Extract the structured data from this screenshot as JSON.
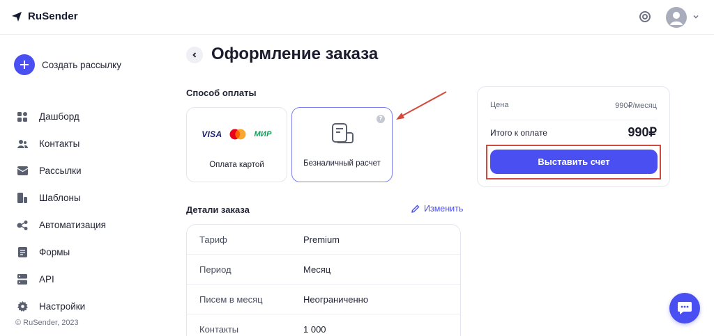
{
  "app": {
    "name": "RuSender"
  },
  "sidebar": {
    "create_label": "Создать рассылку",
    "items": [
      {
        "label": "Дашборд",
        "icon": "dashboard-icon"
      },
      {
        "label": "Контакты",
        "icon": "contacts-icon"
      },
      {
        "label": "Рассылки",
        "icon": "mail-icon"
      },
      {
        "label": "Шаблоны",
        "icon": "templates-icon"
      },
      {
        "label": "Автоматизация",
        "icon": "automation-icon"
      },
      {
        "label": "Формы",
        "icon": "forms-icon"
      },
      {
        "label": "API",
        "icon": "api-icon"
      },
      {
        "label": "Настройки",
        "icon": "settings-icon"
      }
    ],
    "copyright": "© RuSender, 2023"
  },
  "page": {
    "title": "Оформление заказа",
    "payment_method_label": "Способ оплаты",
    "payment_methods": [
      {
        "label": "Оплата картой",
        "brands": [
          "VISA",
          "МИР"
        ]
      },
      {
        "label": "Безналичный расчет",
        "help": "?"
      }
    ],
    "order_details_label": "Детали заказа",
    "edit_label": "Изменить",
    "details": [
      {
        "key": "Тариф",
        "value": "Premium"
      },
      {
        "key": "Период",
        "value": "Месяц"
      },
      {
        "key": "Писем в месяц",
        "value": "Неограниченно"
      },
      {
        "key": "Контакты",
        "value": "1 000"
      }
    ]
  },
  "summary": {
    "price_label": "Цена",
    "price_value": "990₽/месяц",
    "total_label": "Итого к оплате",
    "total_value": "990₽",
    "button_label": "Выставить счет"
  },
  "colors": {
    "accent": "#4a4ff2",
    "annotation": "#d34a3c"
  }
}
